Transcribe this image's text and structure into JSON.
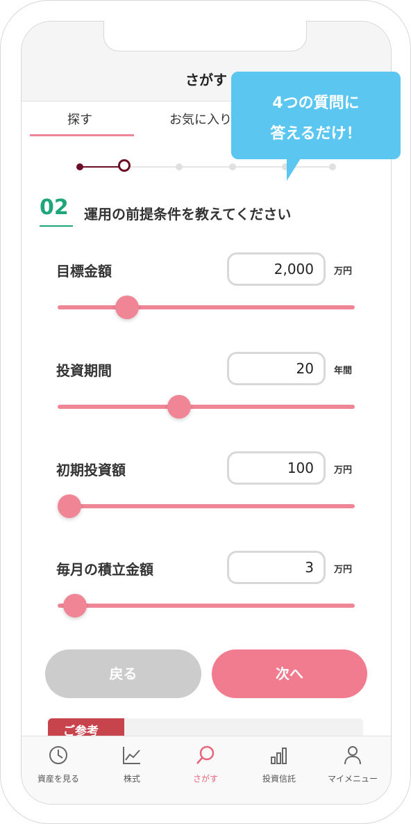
{
  "header": {
    "title": "さがす"
  },
  "tabs": {
    "search": "探す",
    "favorite": "お気に入り"
  },
  "stepper": {
    "current_step": 2,
    "total_steps": 6
  },
  "section": {
    "number": "02",
    "title": "運用の前提条件を教えてください"
  },
  "fields": [
    {
      "label": "目標金額",
      "value": "2,000",
      "unit": "万円",
      "slider_fraction": 0.21
    },
    {
      "label": "投資期間",
      "value": "20",
      "unit": "年間",
      "slider_fraction": 0.4
    },
    {
      "label": "初期投資額",
      "value": "100",
      "unit": "万円",
      "slider_fraction": 0.0
    },
    {
      "label": "毎月の積立金額",
      "value": "3",
      "unit": "万円",
      "slider_fraction": 0.02
    }
  ],
  "buttons": {
    "back": "戻る",
    "next": "次へ"
  },
  "reference": {
    "tag": "ご参考"
  },
  "tabbar": [
    {
      "label": "資産を見る",
      "icon": "clock-icon",
      "active": false
    },
    {
      "label": "株式",
      "icon": "line-chart-icon",
      "active": false
    },
    {
      "label": "さがす",
      "icon": "search-icon",
      "active": true
    },
    {
      "label": "投資信託",
      "icon": "bar-chart-icon",
      "active": false
    },
    {
      "label": "マイメニュー",
      "icon": "person-icon",
      "active": false
    }
  ],
  "callout": {
    "line1": "4つの質問に",
    "line2": "答えるだけ！"
  },
  "colors": {
    "accent": "#f08595",
    "step": "#6b0d25",
    "section": "#1fa57a",
    "callout": "#5bc6ef",
    "reference_tag": "#c8444c"
  }
}
